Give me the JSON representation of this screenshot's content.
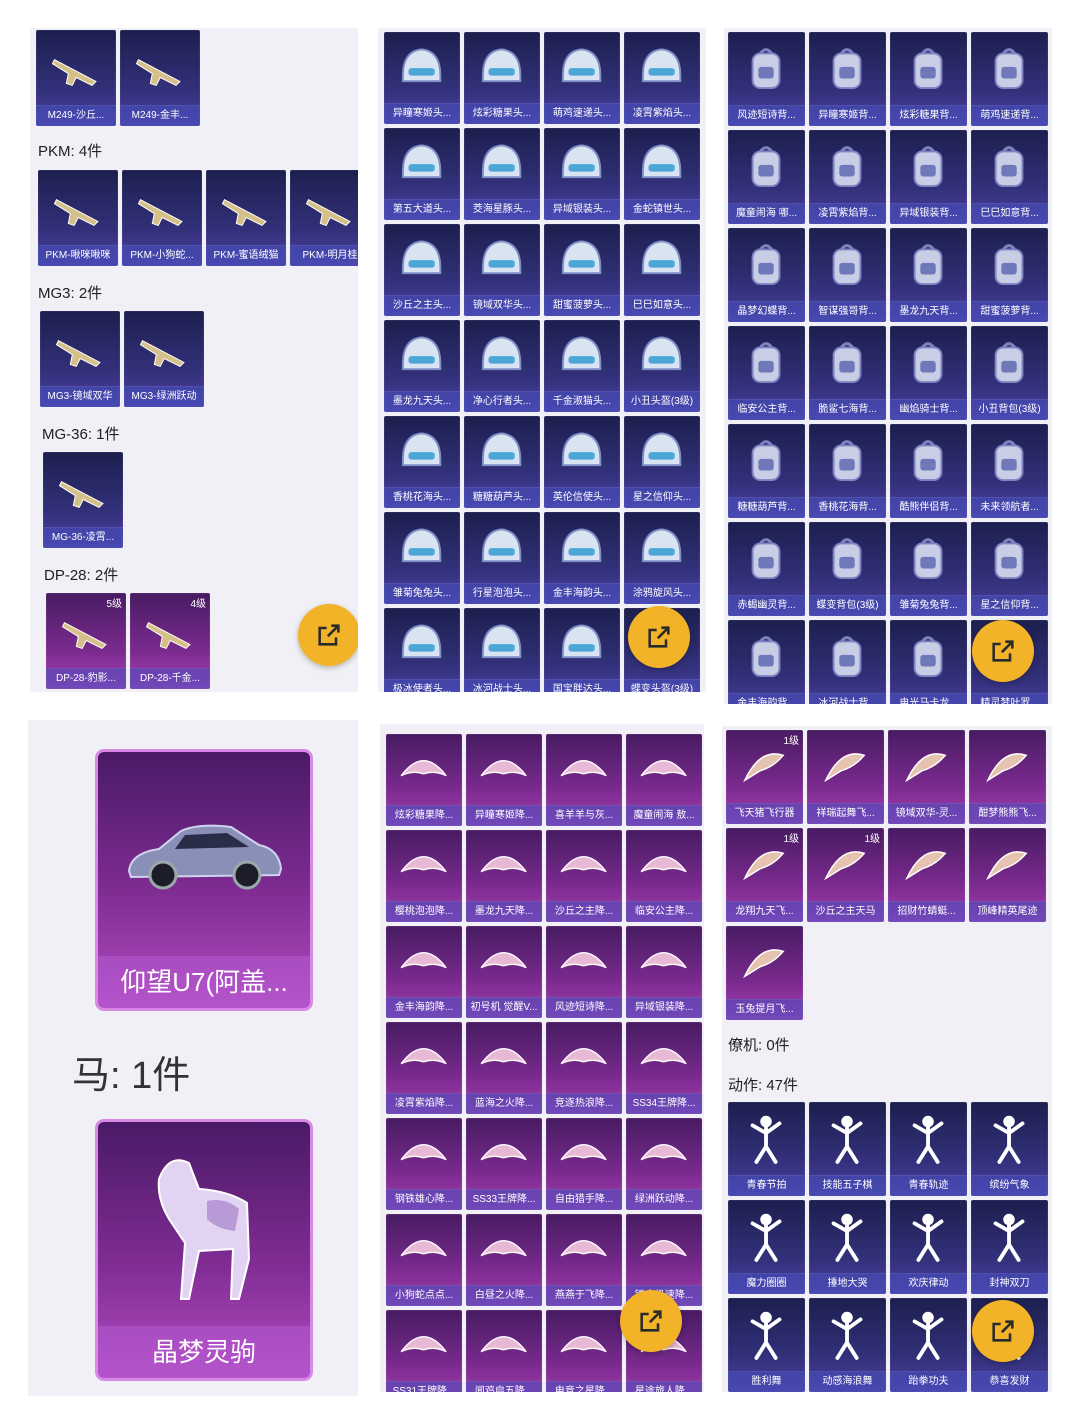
{
  "colors": {
    "accent": "#f3b329",
    "card_blue": "#2c2f6e",
    "card_purple": "#7a2a8e"
  },
  "panel1": {
    "weapons_top": [
      "M249-沙丘...",
      "M249-金丰..."
    ],
    "pkm": {
      "heading": "PKM: 4件",
      "items": [
        "PKM-啾咪啾咪",
        "PKM-小狗蛇...",
        "PKM-蜜语绒猫",
        "PKM-明月桂"
      ]
    },
    "mg3": {
      "heading": "MG3: 2件",
      "items": [
        "MG3-镜域双华",
        "MG3-绿洲跃动"
      ]
    },
    "mg36": {
      "heading": "MG-36: 1件",
      "items": [
        "MG-36-凌霄..."
      ]
    },
    "dp28": {
      "heading": "DP-28: 2件",
      "items": [
        {
          "label": "DP-28-豹影...",
          "level": "5级"
        },
        {
          "label": "DP-28-千金...",
          "level": "4级"
        }
      ]
    }
  },
  "panel2": {
    "items": [
      "异瞳寒姬头...",
      "炫彩糖果头...",
      "萌鸡速递头...",
      "凌霄紫焰头...",
      "第五大道头...",
      "茭海星豚头...",
      "异域银装头...",
      "金蛇镇世头...",
      "沙丘之主头...",
      "镜域双华头...",
      "甜蜜菠萝头...",
      "巳巳如意头...",
      "墨龙九天头...",
      "净心行者头...",
      "千金淑猫头...",
      "小丑头盔(3级)",
      "香桃花海头...",
      "糖糖葫芦头...",
      "英伦信使头...",
      "星之信仰头...",
      "雏菊兔兔头...",
      "行星泡泡头...",
      "金丰海韵头...",
      "涂鸦旋风头...",
      "极冰使者头...",
      "冰河战士头...",
      "国宝胖达头...",
      "蝶变头盔(3级)"
    ]
  },
  "panel3": {
    "items": [
      "风迹短诗背...",
      "异瞳寒姬背...",
      "炫彩糖果背...",
      "萌鸡速递背...",
      "魔童闹海 哪...",
      "凌霄紫焰背...",
      "异域银装背...",
      "巳巳如意背...",
      "晶梦幻蝶背...",
      "智谋强哥背...",
      "墨龙九天背...",
      "甜蜜菠萝背...",
      "临安公主背...",
      "脆鲨七海背...",
      "幽焰骑士背...",
      "小丑背包(3级)",
      "糖糖葫芦背...",
      "香桃花海背...",
      "酷熊伴侣背...",
      "未来领航者...",
      "赤蝎幽灵背...",
      "蝶变背包(3级)",
      "雏菊兔兔背...",
      "星之信仰背...",
      "金丰海韵背...",
      "冰河战士背...",
      "电光马卡龙...",
      "精灵梦叶罗..."
    ]
  },
  "panel4": {
    "vehicle": "仰望U7(阿盖...",
    "horse_heading": "马: 1件",
    "horse": "晶梦灵驹"
  },
  "panel5": {
    "items": [
      "炫彩糖果降...",
      "异瞳寒姬降...",
      "喜羊羊与灰...",
      "魔童闹海 敖...",
      "樱桃泡泡降...",
      "墨龙九天降...",
      "沙丘之主降...",
      "临安公主降...",
      "金丰海韵降...",
      "初号机 觉醒V...",
      "风迹短诗降...",
      "异域银装降...",
      "凌霄紫焰降...",
      "蓝海之火降...",
      "竞逐热浪降...",
      "SS34王牌降...",
      "钢铁雄心降...",
      "SS33王牌降...",
      "自由猎手降...",
      "绿洲跃动降...",
      "小狗蛇点点...",
      "白昼之火降...",
      "燕燕于飞降...",
      "镭金极速降...",
      "SS31王牌降...",
      "闻鸡启五降...",
      "电竞之星降...",
      "星途旅人降..."
    ]
  },
  "panel6": {
    "trails": [
      {
        "label": "飞天猪飞行器",
        "level": "1级"
      },
      {
        "label": "祥瑞起舞飞...",
        "level": ""
      },
      {
        "label": "镜域双华-灵...",
        "level": ""
      },
      {
        "label": "酣梦熊熊飞...",
        "level": ""
      },
      {
        "label": "龙翔九天飞...",
        "level": "1级"
      },
      {
        "label": "沙丘之主天马",
        "level": "1级"
      },
      {
        "label": "招财竹蜻蜓...",
        "level": ""
      },
      {
        "label": "顶峰精英尾迹",
        "level": ""
      },
      {
        "label": "玉兔提月飞...",
        "level": ""
      }
    ],
    "pet_heading": "僚机: 0件",
    "emote_heading": "动作: 47件",
    "emotes": [
      "青春节拍",
      "技能五子棋",
      "青春轨迹",
      "缤纷气象",
      "魔力圈圈",
      "捶地大哭",
      "欢庆律动",
      "封神双刀",
      "胜利舞",
      "动感海浪舞",
      "跆拳功夫",
      "恭喜发财"
    ]
  }
}
